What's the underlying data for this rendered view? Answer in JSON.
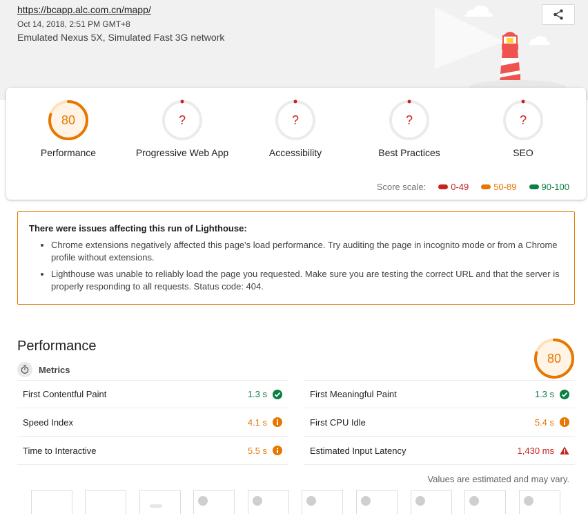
{
  "header": {
    "url": "https://bcapp.alc.com.cn/mapp/",
    "date": "Oct 14, 2018, 2:51 PM GMT+8",
    "device": "Emulated Nexus 5X, Simulated Fast 3G network",
    "share_icon": "share-icon"
  },
  "scores": [
    {
      "label": "Performance",
      "value": "80",
      "status": "orange",
      "fraction": 0.8
    },
    {
      "label": "Progressive Web App",
      "value": "?",
      "status": "error",
      "fraction": 0
    },
    {
      "label": "Accessibility",
      "value": "?",
      "status": "error",
      "fraction": 0
    },
    {
      "label": "Best Practices",
      "value": "?",
      "status": "error",
      "fraction": 0
    },
    {
      "label": "SEO",
      "value": "?",
      "status": "error",
      "fraction": 0
    }
  ],
  "scale": {
    "label": "Score scale:",
    "red": "0-49",
    "orange": "50-89",
    "green": "90-100"
  },
  "warning": {
    "title": "There were issues affecting this run of Lighthouse:",
    "items": [
      "Chrome extensions negatively affected this page's load performance. Try auditing the page in incognito mode or from a Chrome profile without extensions.",
      "Lighthouse was unable to reliably load the page you requested. Make sure you are testing the correct URL and that the server is properly responding to all requests. Status code: 404."
    ]
  },
  "performance": {
    "title": "Performance",
    "score": "80",
    "score_fraction": 0.8,
    "metrics_label": "Metrics",
    "metrics": [
      {
        "name": "First Contentful Paint",
        "value": "1.3 s",
        "status": "green"
      },
      {
        "name": "First Meaningful Paint",
        "value": "1.3 s",
        "status": "green"
      },
      {
        "name": "Speed Index",
        "value": "4.1 s",
        "status": "orange"
      },
      {
        "name": "First CPU Idle",
        "value": "5.4 s",
        "status": "orange"
      },
      {
        "name": "Time to Interactive",
        "value": "5.5 s",
        "status": "orange"
      },
      {
        "name": "Estimated Input Latency",
        "value": "1,430 ms",
        "status": "red"
      }
    ],
    "estimate_note": "Values are estimated and may vary."
  },
  "colors": {
    "orange": "#e67700",
    "red": "#c7221f",
    "green": "#0b8043"
  }
}
